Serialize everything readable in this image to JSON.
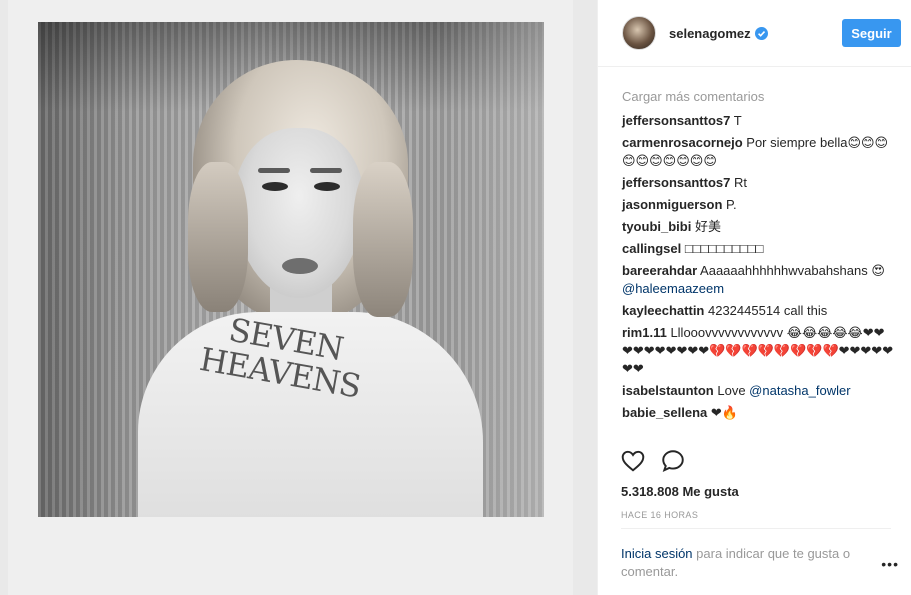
{
  "header": {
    "username": "selenagomez",
    "follow_label": "Seguir"
  },
  "comments": {
    "load_more": "Cargar más comentarios",
    "items": [
      {
        "user": "jeffersonsanttos7",
        "text": " T"
      },
      {
        "user": "carmenrosacornejo",
        "text": " Por siempre bella😊😊😊😊😊😊😊😊😊😊"
      },
      {
        "user": "jeffersonsanttos7",
        "text": " Rt"
      },
      {
        "user": "jasonmiguerson",
        "text": " P."
      },
      {
        "user": "tyoubi_bibi",
        "text": " 好美"
      },
      {
        "user": "callingsel",
        "text": " □□□□□□□□□□"
      },
      {
        "user": "bareerahdar",
        "text": " Aaaaaahhhhhhwvabahshans 😍 ",
        "mention": "@haleemaazeem"
      },
      {
        "user": "kayleechattin",
        "text": " 4232445514 call this"
      },
      {
        "user": "rim1.11",
        "text": " Lllooovvvvvvvvvvvv 😂😂😂😂😂❤❤❤❤❤❤❤❤❤❤💔💔💔💔💔💔💔💔❤❤❤❤❤❤❤"
      },
      {
        "user": "isabelstaunton",
        "text": " Love ",
        "mention": "@natasha_fowler"
      },
      {
        "user": "babie_sellena",
        "text": " ❤🔥"
      }
    ]
  },
  "actions": {
    "like_icon": "heart-outline-icon",
    "comment_icon": "speech-bubble-icon"
  },
  "likes": "5.318.808 Me gusta",
  "time": "HACE 16 HORAS",
  "login": {
    "link": "Inicia sesión",
    "text": " para indicar que te gusta o comentar."
  },
  "more": "•••",
  "colors": {
    "accent": "#3897f0",
    "link": "#003569",
    "muted": "#999999"
  }
}
